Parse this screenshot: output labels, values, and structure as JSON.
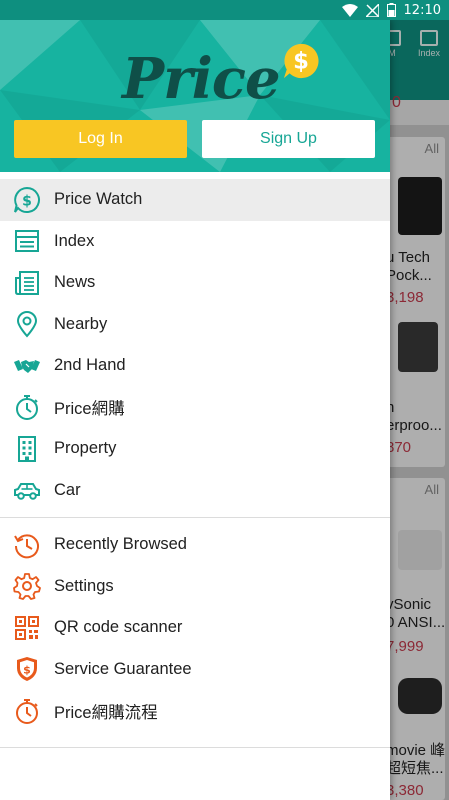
{
  "status_bar": {
    "time": "12:10"
  },
  "background_app": {
    "toolbar_items": [
      "M",
      "Index"
    ],
    "top_price_fragment": "0",
    "cards": [
      {
        "all_label": "All",
        "products": [
          {
            "name_line1": "u Tech",
            "name_line2": "Pock...",
            "price": "3,198"
          },
          {
            "name_line1": "n",
            "name_line2": "erproo...",
            "price": "870"
          }
        ]
      },
      {
        "all_label": "All",
        "products": [
          {
            "name_line1": "vSonic",
            "name_line2": "0 ANSI...",
            "price": "7,999"
          },
          {
            "name_line1": "movie 峰",
            "name_line2": "超短焦...",
            "price": "3,380"
          }
        ]
      }
    ]
  },
  "drawer": {
    "logo_text": "Price",
    "login_label": "Log In",
    "signup_label": "Sign Up",
    "menu_primary": [
      {
        "label": "Price Watch",
        "icon": "price-watch-icon",
        "active": true
      },
      {
        "label": "Index",
        "icon": "index-icon"
      },
      {
        "label": "News",
        "icon": "news-icon"
      },
      {
        "label": "Nearby",
        "icon": "location-pin-icon"
      },
      {
        "label": "2nd Hand",
        "icon": "handshake-icon"
      },
      {
        "label": "Price網購",
        "icon": "stopwatch-icon"
      },
      {
        "label": "Property",
        "icon": "building-icon"
      },
      {
        "label": "Car",
        "icon": "car-icon"
      }
    ],
    "menu_secondary": [
      {
        "label": "Recently Browsed",
        "icon": "history-icon"
      },
      {
        "label": "Settings",
        "icon": "gear-icon"
      },
      {
        "label": "QR code scanner",
        "icon": "qr-code-icon"
      },
      {
        "label": "Service Guarantee",
        "icon": "shield-dollar-icon"
      },
      {
        "label": "Price網購流程",
        "icon": "stopwatch-icon"
      }
    ]
  },
  "colors": {
    "teal": "#17b3a0",
    "teal_dark": "#0f4f48",
    "accent_orange": "#e85a1c",
    "login_yellow": "#f8c623",
    "price_red": "#c23a4b"
  }
}
